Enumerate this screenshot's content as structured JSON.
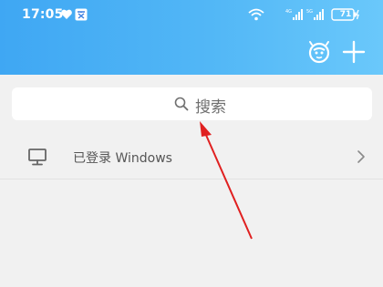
{
  "status_bar": {
    "time": "17:05",
    "network_labels": [
      "4G",
      "5G"
    ],
    "battery_level": "71"
  },
  "header": {
    "icons": [
      "robot-assistant-icon",
      "add-icon"
    ]
  },
  "search": {
    "label": "搜索",
    "icon": "search-icon"
  },
  "login_row": {
    "label": "已登录 Windows",
    "icon": "monitor-icon",
    "trailing_icon": "chevron-right-icon"
  },
  "colors": {
    "header_gradient_start": "#3fa7f3",
    "header_gradient_end": "#6ac8fb",
    "background": "#f1f1f1",
    "annotation_arrow": "#e02020"
  }
}
